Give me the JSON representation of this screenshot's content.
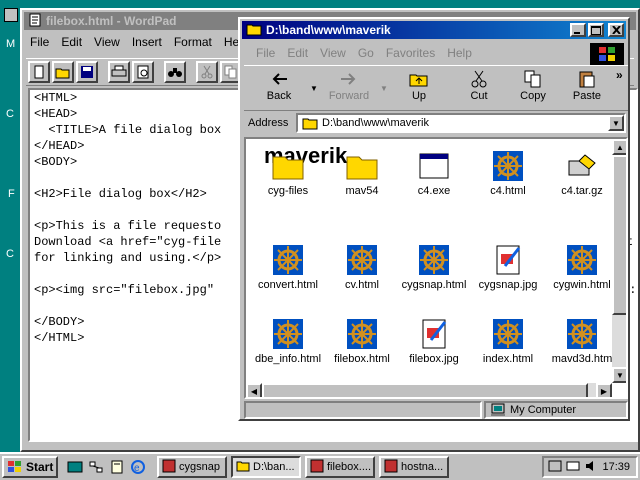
{
  "desktop": {
    "edge_labels": [
      "M",
      "C",
      "F",
      "C"
    ]
  },
  "wordpad": {
    "title": "filebox.html - WordPad",
    "menu": [
      "File",
      "Edit",
      "View",
      "Insert",
      "Format",
      "Help"
    ],
    "lines": [
      "<HTML>",
      "<HEAD>",
      "  <TITLE>A file dialog box",
      "</HEAD>",
      "<BODY>",
      "",
      "<H2>File dialog box</H2>",
      "",
      "<p>This is a file requesto",
      "Download <a href=\"cyg-file",
      "for linking and using.</p>",
      "",
      "<p><img src=\"filebox.jpg\"",
      "",
      "</BODY>",
      "</HTML>"
    ],
    "right_edge_fragments": [
      "t",
      "p:"
    ]
  },
  "explorer": {
    "title": "D:\\band\\www\\maverik",
    "menu": [
      "File",
      "Edit",
      "View",
      "Go",
      "Favorites",
      "Help"
    ],
    "toolbar": {
      "back": "Back",
      "forward": "Forward",
      "up": "Up",
      "cut": "Cut",
      "copy": "Copy",
      "paste": "Paste",
      "more": "»"
    },
    "address_label": "Address",
    "address_value": "D:\\band\\www\\maverik",
    "folder_title": "maverik",
    "files": [
      {
        "name": "cyg-files",
        "icon": "folder-icon"
      },
      {
        "name": "mav54",
        "icon": "folder-icon"
      },
      {
        "name": "c4.exe",
        "icon": "exe-icon"
      },
      {
        "name": "c4.html",
        "icon": "html-wheel-icon"
      },
      {
        "name": "c4.tar.gz",
        "icon": "archive-icon"
      },
      {
        "name": "convert.html",
        "icon": "html-wheel-icon"
      },
      {
        "name": "cv.html",
        "icon": "html-wheel-icon"
      },
      {
        "name": "cygsnap.html",
        "icon": "html-wheel-icon"
      },
      {
        "name": "cygsnap.jpg",
        "icon": "jpg-icon"
      },
      {
        "name": "cygwin.html",
        "icon": "html-wheel-icon"
      },
      {
        "name": "dbe_info.html",
        "icon": "html-wheel-icon"
      },
      {
        "name": "filebox.html",
        "icon": "html-wheel-icon"
      },
      {
        "name": "filebox.jpg",
        "icon": "jpg-icon"
      },
      {
        "name": "index.html",
        "icon": "html-wheel-icon"
      },
      {
        "name": "mavd3d.htm",
        "icon": "html-wheel-icon"
      }
    ],
    "status": "My Computer"
  },
  "taskbar": {
    "start": "Start",
    "tasks": [
      {
        "label": "cygsnap",
        "icon": "paint-icon"
      },
      {
        "label": "D:\\ban...",
        "icon": "folder-icon"
      },
      {
        "label": "filebox....",
        "icon": "wordpad-icon"
      },
      {
        "label": "hostna...",
        "icon": "app-icon"
      }
    ],
    "time": "17:39"
  },
  "colors": {
    "desktop": "#008080",
    "active_title": "#000080",
    "inactive_title": "#808080",
    "face": "#c0c0c0"
  }
}
